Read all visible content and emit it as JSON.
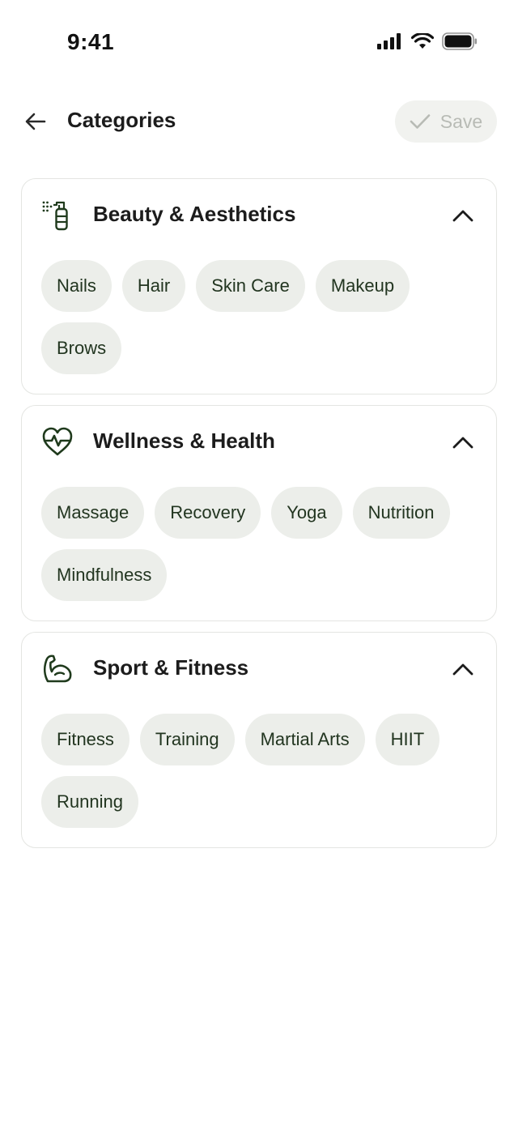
{
  "status_bar": {
    "time": "9:41"
  },
  "header": {
    "title": "Categories",
    "save_label": "Save"
  },
  "colors": {
    "chip_bg": "#eceeea",
    "chip_text": "#223520",
    "icon_green": "#1f3a1c",
    "disabled": "#b8bbb5"
  },
  "categories": [
    {
      "title": "Beauty & Aesthetics",
      "icon": "spray-bottle-icon",
      "chips": [
        "Nails",
        "Hair",
        "Skin Care",
        "Makeup",
        "Brows"
      ]
    },
    {
      "title": "Wellness & Health",
      "icon": "heart-pulse-icon",
      "chips": [
        "Massage",
        "Recovery",
        "Yoga",
        "Nutrition",
        "Mindfulness"
      ]
    },
    {
      "title": "Sport & Fitness",
      "icon": "flexed-arm-icon",
      "chips": [
        "Fitness",
        "Training",
        "Martial Arts",
        "HIIT",
        "Running"
      ]
    }
  ]
}
